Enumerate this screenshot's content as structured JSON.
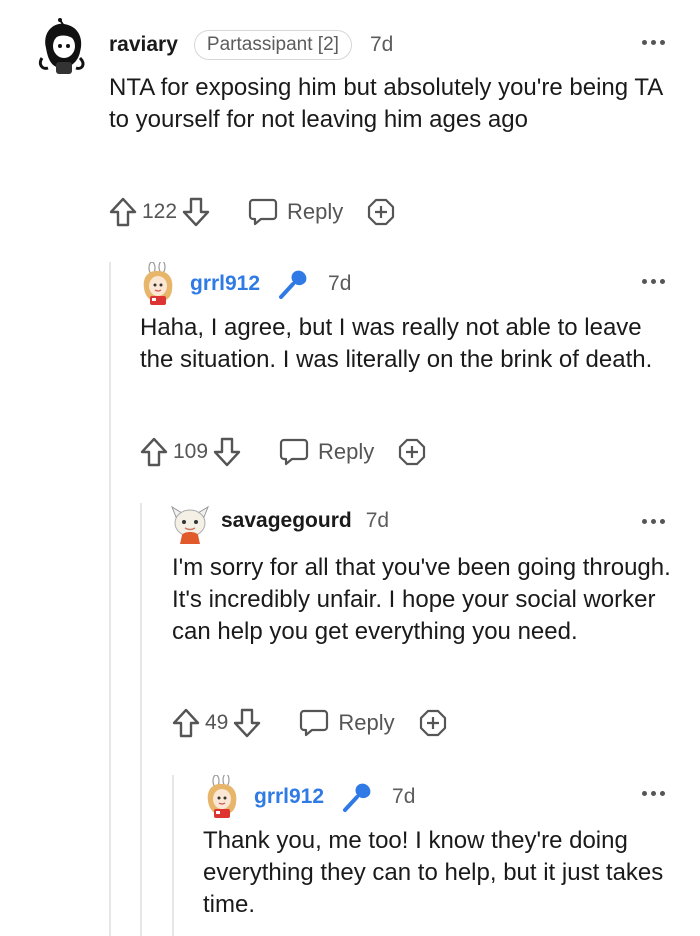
{
  "comments": [
    {
      "username": "raviary",
      "flair": "Partassipant [2]",
      "time": "7d",
      "body": "NTA for exposing him but absolutely you're being TA to yourself for not leaving him ages ago",
      "votes": "122",
      "reply_label": "Reply"
    },
    {
      "username": "grrl912",
      "time": "7d",
      "body": "Haha, I agree, but I was really not able to leave the situation. I was literally on the brink of death.",
      "votes": "109",
      "reply_label": "Reply"
    },
    {
      "username": "savagegourd",
      "time": "7d",
      "body": "I'm sorry for all that you've been going through. It's incredibly unfair. I hope your social worker can help you get everything you need.",
      "votes": "49",
      "reply_label": "Reply"
    },
    {
      "username": "grrl912",
      "time": "7d",
      "body": "Thank you, me too! I know they're doing everything they can to help, but it just takes time."
    }
  ],
  "colors": {
    "op_username": "#2f7ae5",
    "text": "#1a1a1b",
    "meta": "#5c5c5c",
    "thread_line": "#e6e6e6"
  },
  "icons": [
    "avatar",
    "mic-icon",
    "upvote-icon",
    "downvote-icon",
    "reply-icon",
    "award-icon",
    "more-options-icon"
  ]
}
